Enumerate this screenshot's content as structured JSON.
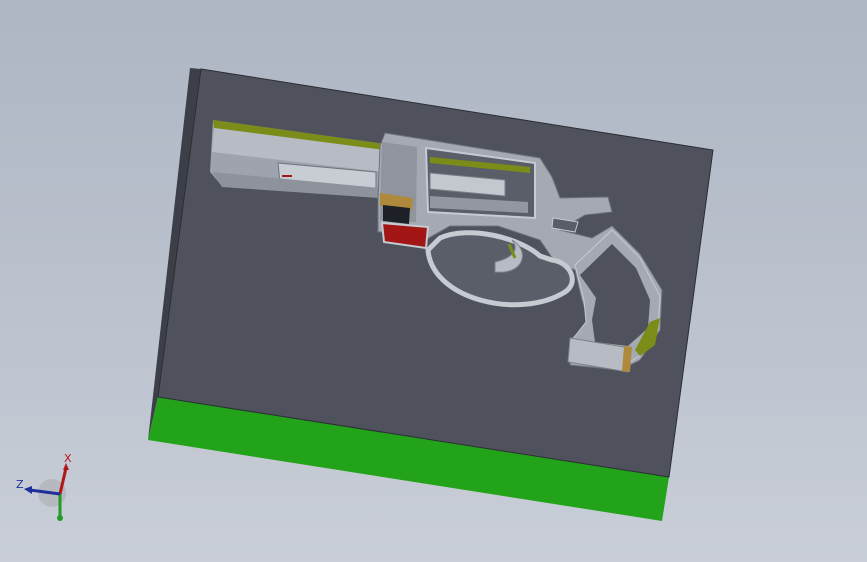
{
  "viewport": {
    "background_top": "#aeb6c4",
    "background_bottom": "#c9ced7"
  },
  "model": {
    "top_face_color": "#4f525c",
    "side_face_color": "#3f424b",
    "bottom_face_color": "#22a31a",
    "cavity_wall_color": "#a3a8b1",
    "cavity_highlight_color": "#c6cad1",
    "accent_olive": "#7b8d18",
    "accent_red": "#a21616",
    "accent_tan": "#b08a3c"
  },
  "triad": {
    "x_label": "X",
    "z_label": "Z",
    "x_color": "#b01818",
    "z_color": "#1f2f9c",
    "y_color": "#1f9c26"
  }
}
